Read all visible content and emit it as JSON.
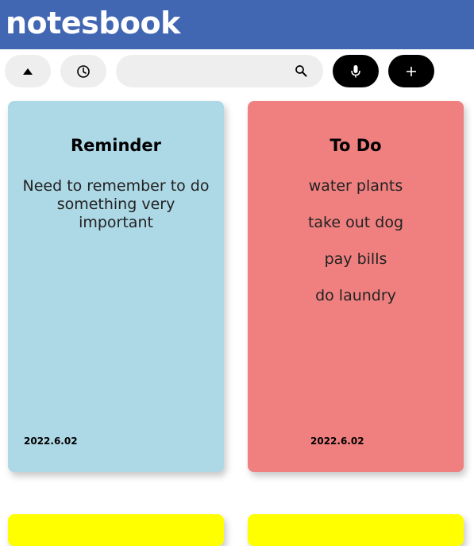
{
  "app": {
    "title": "notesbook"
  },
  "toolbar": {
    "sort_icon": "triangle-up-icon",
    "recent_icon": "clock-icon",
    "search": {
      "value": "",
      "placeholder": "",
      "icon": "search-icon"
    },
    "mic_icon": "microphone-icon",
    "add_icon": "plus-icon"
  },
  "colors": {
    "header": "#4166b2",
    "card_blue": "#add8e6",
    "card_red": "#f08080",
    "card_yellow": "#ffff00"
  },
  "notes": [
    {
      "title": "Reminder",
      "body": "Need to remember to do something very important",
      "date": "2022.6.02",
      "color": "#add8e6"
    },
    {
      "title": "To Do",
      "items": [
        "water plants",
        "take out dog",
        "pay bills",
        "do laundry"
      ],
      "date": "2022.6.02",
      "color": "#f08080"
    },
    {
      "title": "",
      "color": "#ffff00"
    },
    {
      "title": "",
      "color": "#ffff00"
    }
  ]
}
